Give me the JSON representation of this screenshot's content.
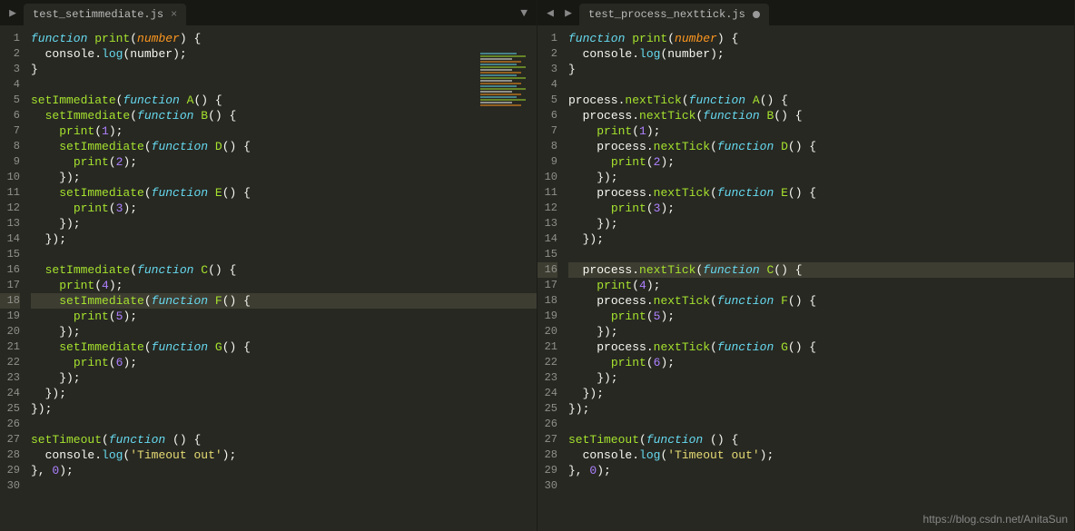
{
  "left": {
    "tab_name": "test_setimmediate.js",
    "tab_modified": false,
    "highlighted_line": 18,
    "lines": [
      [
        [
          "kw",
          "function "
        ],
        [
          "fn",
          "print"
        ],
        [
          "punct",
          "("
        ],
        [
          "param",
          "number"
        ],
        [
          "punct",
          ") {"
        ]
      ],
      [
        [
          "punct",
          "  "
        ],
        [
          "obj",
          "console"
        ],
        [
          "punct",
          "."
        ],
        [
          "call",
          "log"
        ],
        [
          "punct",
          "("
        ],
        [
          "obj",
          "number"
        ],
        [
          "punct",
          ");"
        ]
      ],
      [
        [
          "punct",
          "}"
        ]
      ],
      [],
      [
        [
          "fn",
          "setImmediate"
        ],
        [
          "punct",
          "("
        ],
        [
          "kw",
          "function "
        ],
        [
          "fn",
          "A"
        ],
        [
          "punct",
          "() {"
        ]
      ],
      [
        [
          "punct",
          "  "
        ],
        [
          "fn",
          "setImmediate"
        ],
        [
          "punct",
          "("
        ],
        [
          "kw",
          "function "
        ],
        [
          "fn",
          "B"
        ],
        [
          "punct",
          "() {"
        ]
      ],
      [
        [
          "punct",
          "    "
        ],
        [
          "fn",
          "print"
        ],
        [
          "punct",
          "("
        ],
        [
          "num",
          "1"
        ],
        [
          "punct",
          ");"
        ]
      ],
      [
        [
          "punct",
          "    "
        ],
        [
          "fn",
          "setImmediate"
        ],
        [
          "punct",
          "("
        ],
        [
          "kw",
          "function "
        ],
        [
          "fn",
          "D"
        ],
        [
          "punct",
          "() {"
        ]
      ],
      [
        [
          "punct",
          "      "
        ],
        [
          "fn",
          "print"
        ],
        [
          "punct",
          "("
        ],
        [
          "num",
          "2"
        ],
        [
          "punct",
          ");"
        ]
      ],
      [
        [
          "punct",
          "    });"
        ]
      ],
      [
        [
          "punct",
          "    "
        ],
        [
          "fn",
          "setImmediate"
        ],
        [
          "punct",
          "("
        ],
        [
          "kw",
          "function "
        ],
        [
          "fn",
          "E"
        ],
        [
          "punct",
          "() {"
        ]
      ],
      [
        [
          "punct",
          "      "
        ],
        [
          "fn",
          "print"
        ],
        [
          "punct",
          "("
        ],
        [
          "num",
          "3"
        ],
        [
          "punct",
          ");"
        ]
      ],
      [
        [
          "punct",
          "    });"
        ]
      ],
      [
        [
          "punct",
          "  });"
        ]
      ],
      [],
      [
        [
          "punct",
          "  "
        ],
        [
          "fn",
          "setImmediate"
        ],
        [
          "punct",
          "("
        ],
        [
          "kw",
          "function "
        ],
        [
          "fn",
          "C"
        ],
        [
          "punct",
          "() {"
        ]
      ],
      [
        [
          "punct",
          "    "
        ],
        [
          "fn",
          "print"
        ],
        [
          "punct",
          "("
        ],
        [
          "num",
          "4"
        ],
        [
          "punct",
          ");"
        ]
      ],
      [
        [
          "punct",
          "    "
        ],
        [
          "fn",
          "setImmediate"
        ],
        [
          "punct",
          "("
        ],
        [
          "kw",
          "function "
        ],
        [
          "fn",
          "F"
        ],
        [
          "punct",
          "() {"
        ]
      ],
      [
        [
          "punct",
          "      "
        ],
        [
          "fn",
          "print"
        ],
        [
          "punct",
          "("
        ],
        [
          "num",
          "5"
        ],
        [
          "punct",
          ");"
        ]
      ],
      [
        [
          "punct",
          "    });"
        ]
      ],
      [
        [
          "punct",
          "    "
        ],
        [
          "fn",
          "setImmediate"
        ],
        [
          "punct",
          "("
        ],
        [
          "kw",
          "function "
        ],
        [
          "fn",
          "G"
        ],
        [
          "punct",
          "() {"
        ]
      ],
      [
        [
          "punct",
          "      "
        ],
        [
          "fn",
          "print"
        ],
        [
          "punct",
          "("
        ],
        [
          "num",
          "6"
        ],
        [
          "punct",
          ");"
        ]
      ],
      [
        [
          "punct",
          "    });"
        ]
      ],
      [
        [
          "punct",
          "  });"
        ]
      ],
      [
        [
          "punct",
          "});"
        ]
      ],
      [],
      [
        [
          "fn",
          "setTimeout"
        ],
        [
          "punct",
          "("
        ],
        [
          "kw",
          "function "
        ],
        [
          "punct",
          "() {"
        ]
      ],
      [
        [
          "punct",
          "  "
        ],
        [
          "obj",
          "console"
        ],
        [
          "punct",
          "."
        ],
        [
          "call",
          "log"
        ],
        [
          "punct",
          "("
        ],
        [
          "str",
          "'Timeout out'"
        ],
        [
          "punct",
          ");"
        ]
      ],
      [
        [
          "punct",
          "}, "
        ],
        [
          "num",
          "0"
        ],
        [
          "punct",
          ");"
        ]
      ],
      []
    ]
  },
  "right": {
    "tab_name": "test_process_nexttick.js",
    "tab_modified": true,
    "highlighted_line": 16,
    "lines": [
      [
        [
          "kw",
          "function "
        ],
        [
          "fn",
          "print"
        ],
        [
          "punct",
          "("
        ],
        [
          "param",
          "number"
        ],
        [
          "punct",
          ") {"
        ]
      ],
      [
        [
          "punct",
          "  "
        ],
        [
          "obj",
          "console"
        ],
        [
          "punct",
          "."
        ],
        [
          "call",
          "log"
        ],
        [
          "punct",
          "("
        ],
        [
          "obj",
          "number"
        ],
        [
          "punct",
          ");"
        ]
      ],
      [
        [
          "punct",
          "}"
        ]
      ],
      [],
      [
        [
          "obj",
          "process"
        ],
        [
          "punct",
          "."
        ],
        [
          "fn",
          "nextTick"
        ],
        [
          "punct",
          "("
        ],
        [
          "kw",
          "function "
        ],
        [
          "fn",
          "A"
        ],
        [
          "punct",
          "() {"
        ]
      ],
      [
        [
          "punct",
          "  "
        ],
        [
          "obj",
          "process"
        ],
        [
          "punct",
          "."
        ],
        [
          "fn",
          "nextTick"
        ],
        [
          "punct",
          "("
        ],
        [
          "kw",
          "function "
        ],
        [
          "fn",
          "B"
        ],
        [
          "punct",
          "() {"
        ]
      ],
      [
        [
          "punct",
          "    "
        ],
        [
          "fn",
          "print"
        ],
        [
          "punct",
          "("
        ],
        [
          "num",
          "1"
        ],
        [
          "punct",
          ");"
        ]
      ],
      [
        [
          "punct",
          "    "
        ],
        [
          "obj",
          "process"
        ],
        [
          "punct",
          "."
        ],
        [
          "fn",
          "nextTick"
        ],
        [
          "punct",
          "("
        ],
        [
          "kw",
          "function "
        ],
        [
          "fn",
          "D"
        ],
        [
          "punct",
          "() {"
        ]
      ],
      [
        [
          "punct",
          "      "
        ],
        [
          "fn",
          "print"
        ],
        [
          "punct",
          "("
        ],
        [
          "num",
          "2"
        ],
        [
          "punct",
          ");"
        ]
      ],
      [
        [
          "punct",
          "    });"
        ]
      ],
      [
        [
          "punct",
          "    "
        ],
        [
          "obj",
          "process"
        ],
        [
          "punct",
          "."
        ],
        [
          "fn",
          "nextTick"
        ],
        [
          "punct",
          "("
        ],
        [
          "kw",
          "function "
        ],
        [
          "fn",
          "E"
        ],
        [
          "punct",
          "() {"
        ]
      ],
      [
        [
          "punct",
          "      "
        ],
        [
          "fn",
          "print"
        ],
        [
          "punct",
          "("
        ],
        [
          "num",
          "3"
        ],
        [
          "punct",
          ");"
        ]
      ],
      [
        [
          "punct",
          "    });"
        ]
      ],
      [
        [
          "punct",
          "  });"
        ]
      ],
      [],
      [
        [
          "punct",
          "  "
        ],
        [
          "obj",
          "process"
        ],
        [
          "punct",
          "."
        ],
        [
          "fn",
          "nextTick"
        ],
        [
          "punct",
          "("
        ],
        [
          "kw",
          "function "
        ],
        [
          "fn",
          "C"
        ],
        [
          "punct",
          "() {"
        ]
      ],
      [
        [
          "punct",
          "    "
        ],
        [
          "fn",
          "print"
        ],
        [
          "punct",
          "("
        ],
        [
          "num",
          "4"
        ],
        [
          "punct",
          ");"
        ]
      ],
      [
        [
          "punct",
          "    "
        ],
        [
          "obj",
          "process"
        ],
        [
          "punct",
          "."
        ],
        [
          "fn",
          "nextTick"
        ],
        [
          "punct",
          "("
        ],
        [
          "kw",
          "function "
        ],
        [
          "fn",
          "F"
        ],
        [
          "punct",
          "() {"
        ]
      ],
      [
        [
          "punct",
          "      "
        ],
        [
          "fn",
          "print"
        ],
        [
          "punct",
          "("
        ],
        [
          "num",
          "5"
        ],
        [
          "punct",
          ");"
        ]
      ],
      [
        [
          "punct",
          "    });"
        ]
      ],
      [
        [
          "punct",
          "    "
        ],
        [
          "obj",
          "process"
        ],
        [
          "punct",
          "."
        ],
        [
          "fn",
          "nextTick"
        ],
        [
          "punct",
          "("
        ],
        [
          "kw",
          "function "
        ],
        [
          "fn",
          "G"
        ],
        [
          "punct",
          "() {"
        ]
      ],
      [
        [
          "punct",
          "      "
        ],
        [
          "fn",
          "print"
        ],
        [
          "punct",
          "("
        ],
        [
          "num",
          "6"
        ],
        [
          "punct",
          ");"
        ]
      ],
      [
        [
          "punct",
          "    });"
        ]
      ],
      [
        [
          "punct",
          "  });"
        ]
      ],
      [
        [
          "punct",
          "});"
        ]
      ],
      [],
      [
        [
          "fn",
          "setTimeout"
        ],
        [
          "punct",
          "("
        ],
        [
          "kw",
          "function "
        ],
        [
          "punct",
          "() {"
        ]
      ],
      [
        [
          "punct",
          "  "
        ],
        [
          "obj",
          "console"
        ],
        [
          "punct",
          "."
        ],
        [
          "call",
          "log"
        ],
        [
          "punct",
          "("
        ],
        [
          "str",
          "'Timeout out'"
        ],
        [
          "punct",
          ");"
        ]
      ],
      [
        [
          "punct",
          "}, "
        ],
        [
          "num",
          "0"
        ],
        [
          "punct",
          ");"
        ]
      ],
      []
    ]
  },
  "watermark": "https://blog.csdn.net/AnitaSun"
}
